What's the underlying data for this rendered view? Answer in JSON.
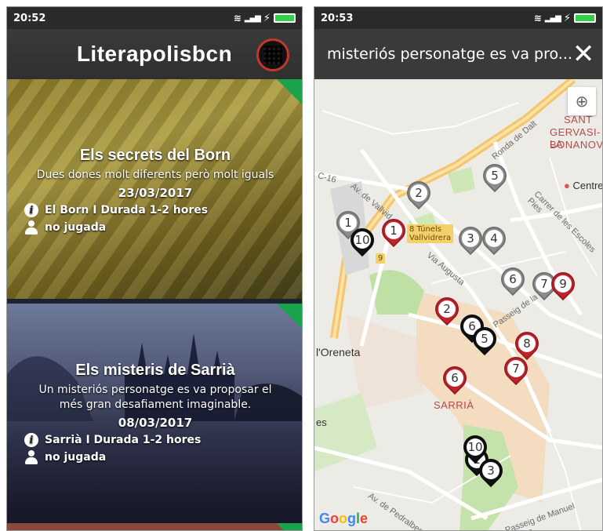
{
  "left_phone": {
    "status": {
      "time": "20:52"
    },
    "app_title": "Literapolisbcn",
    "cards": [
      {
        "title": "Els secrets del Born",
        "description": "Dues dones molt diferents però molt iguals",
        "date": "23/03/2017",
        "location": "El Born I Durada 1-2 hores",
        "state": "no jugada"
      },
      {
        "title": "Els misteris de Sarrià",
        "description": "Un misteriós personatge es va proposar el més gran desafiament imaginable.",
        "date": "08/03/2017",
        "location": "Sarrià I Durada 1-2 hores",
        "state": "no jugada"
      }
    ]
  },
  "right_phone": {
    "status": {
      "time": "20:53"
    },
    "search_title": "misteriós personatge es va pro...",
    "map": {
      "labels": {
        "sant": "SANT",
        "gervasi": "GERVASI-LA",
        "bonanova": "BONANOVA",
        "centre": "Centre",
        "oreneta": "l'Oreneta",
        "sarria": "SARRIÀ",
        "es": "es",
        "tunels_1": "8 Túnels",
        "tunels_2": "Vallvidrera",
        "ronda": "Ronda de Dalt",
        "escoles": "Carrer de les Escoles Pies",
        "via_augusta": "Via Augusta",
        "vallvidrera": "Av. de Vallvid",
        "passeig_bo": "Passeig de la Bo",
        "passeig_manuel": "Passeig de Manuel Girona",
        "pedralbes": "Av. de Pedralbes",
        "c16": "C-16",
        "ronda_tag": "9"
      },
      "pins": [
        {
          "n": "1",
          "color": "gray"
        },
        {
          "n": "10",
          "color": "black"
        },
        {
          "n": "1",
          "color": "red"
        },
        {
          "n": "2",
          "color": "gray"
        },
        {
          "n": "5",
          "color": "gray"
        },
        {
          "n": "3",
          "color": "gray"
        },
        {
          "n": "4",
          "color": "gray"
        },
        {
          "n": "6",
          "color": "gray"
        },
        {
          "n": "7",
          "color": "gray"
        },
        {
          "n": "9",
          "color": "red"
        },
        {
          "n": "2",
          "color": "red"
        },
        {
          "n": "6",
          "color": "black"
        },
        {
          "n": "5",
          "color": "black"
        },
        {
          "n": "8",
          "color": "red"
        },
        {
          "n": "7",
          "color": "red"
        },
        {
          "n": "6",
          "color": "red"
        },
        {
          "n": "1",
          "color": "black"
        },
        {
          "n": "3",
          "color": "black"
        },
        {
          "n": "10",
          "color": "black"
        }
      ],
      "google_letters": [
        "G",
        "o",
        "o",
        "g",
        "l",
        "e"
      ]
    }
  }
}
